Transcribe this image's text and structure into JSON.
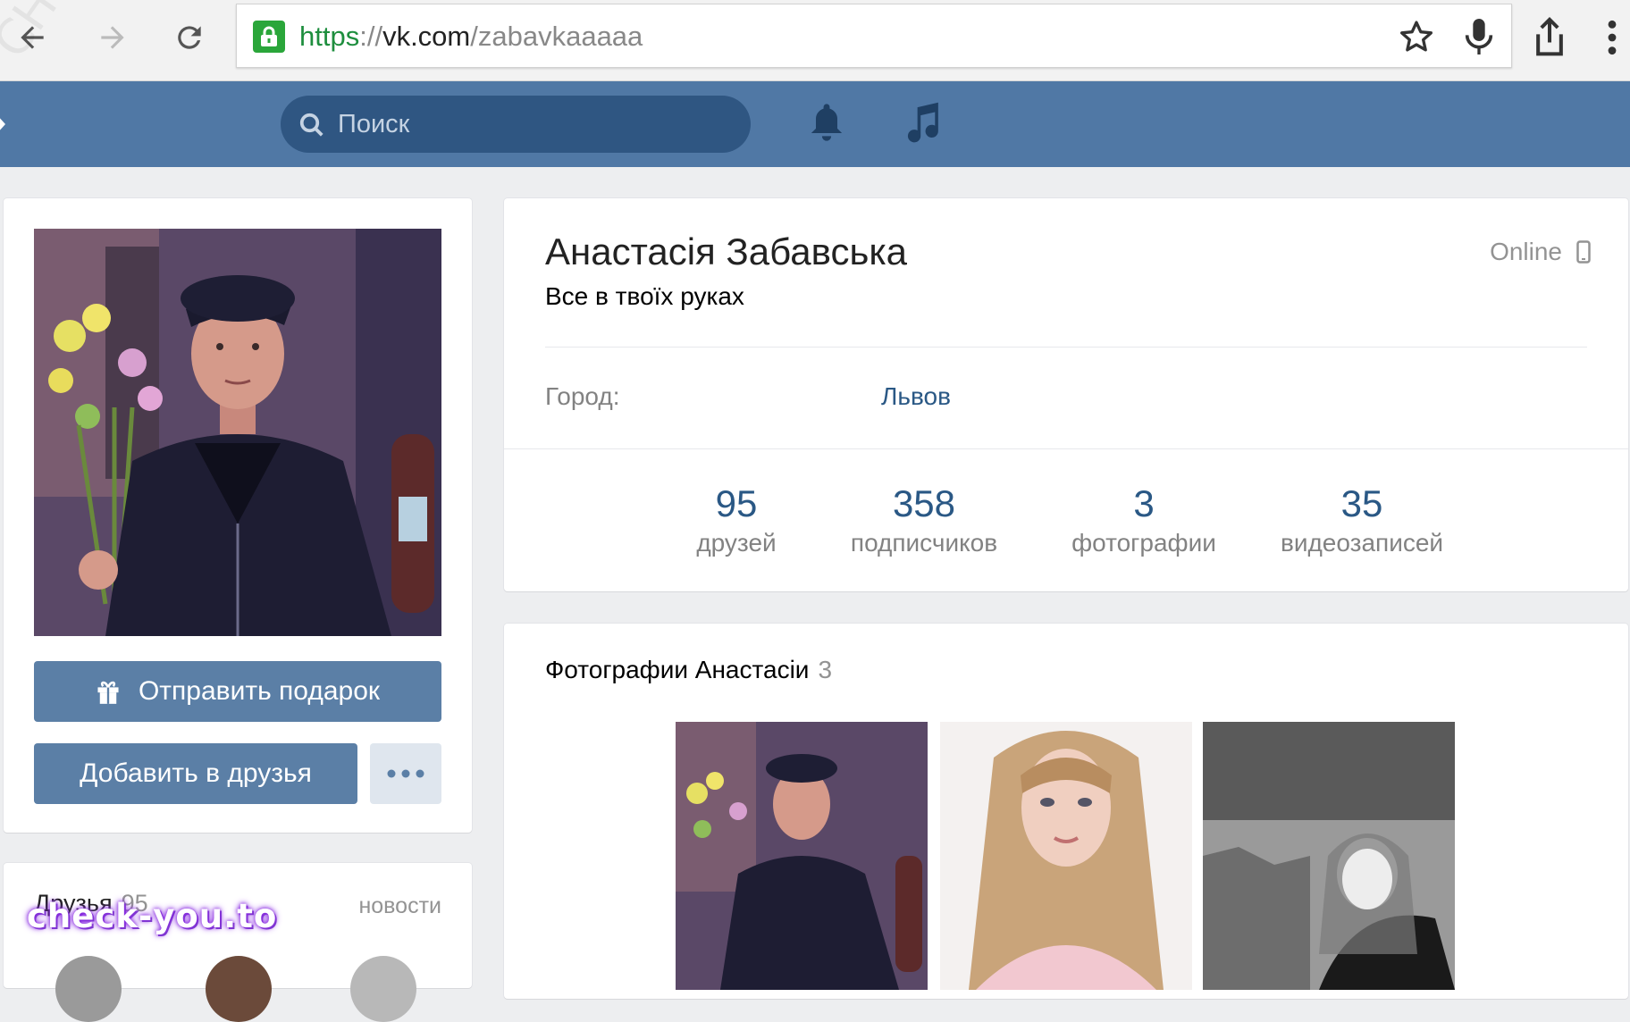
{
  "browser": {
    "url_scheme": "https",
    "url_sep": "://",
    "url_host": "vk.com",
    "url_path": "/zabavkaaaaa"
  },
  "header": {
    "search_placeholder": "Поиск"
  },
  "profile": {
    "name": "Анастасія Забавська",
    "status": "Все в твоїх руках",
    "online": "Online",
    "city_label": "Город:",
    "city_value": "Львов",
    "counters": [
      {
        "num": "95",
        "label": "друзей"
      },
      {
        "num": "358",
        "label": "подписчиков"
      },
      {
        "num": "3",
        "label": "фотографии"
      },
      {
        "num": "35",
        "label": "видеозаписей"
      }
    ]
  },
  "actions": {
    "gift": "Отправить подарок",
    "add_friend": "Добавить в друзья"
  },
  "friends": {
    "title": "Друзья",
    "count": "95",
    "news": "новости"
  },
  "photos": {
    "title": "Фотографии Анастасіи",
    "count": "3"
  },
  "watermark": "check-you.to",
  "diagonal_watermark": "CHECK-YOU.ME",
  "colors": {
    "vk_header": "#5078a5",
    "button": "#5b7fa6",
    "link": "#2a5885"
  }
}
